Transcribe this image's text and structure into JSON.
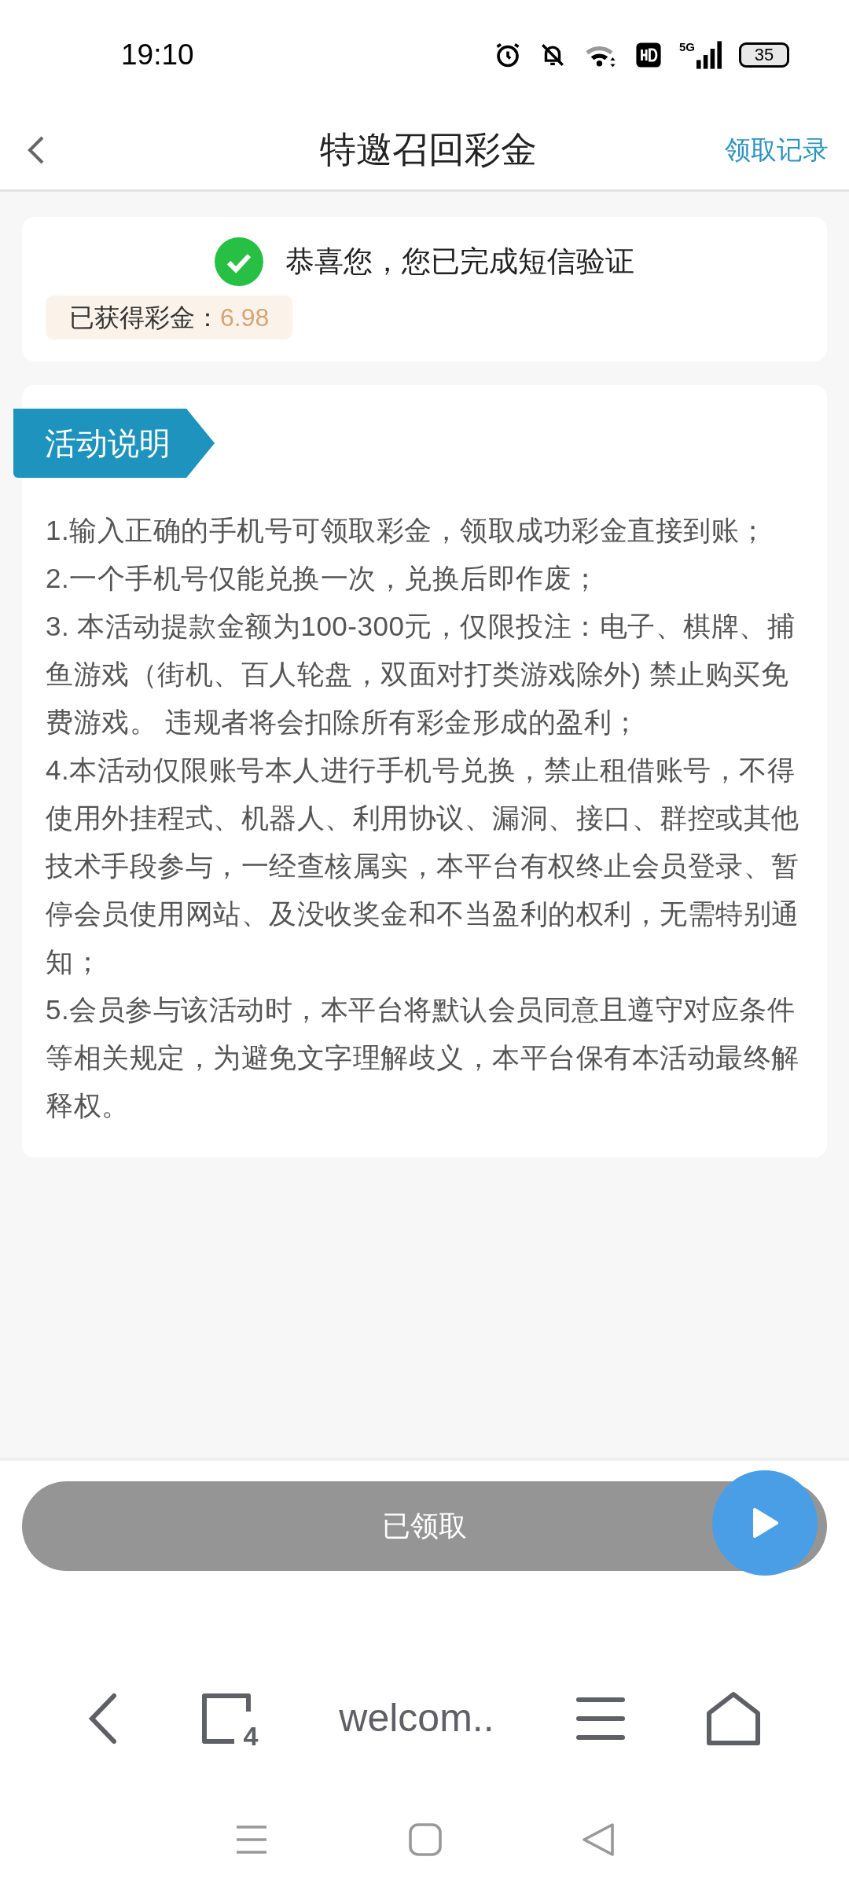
{
  "status_bar": {
    "time": "19:10",
    "network": "5G",
    "battery": "35"
  },
  "header": {
    "title": "特邀召回彩金",
    "action": "领取记录"
  },
  "result": {
    "verified": true,
    "message": "恭喜您，您已完成短信验证",
    "bonus_label": "已获得彩金：",
    "bonus_value": "6.98"
  },
  "rules": {
    "title": "活动说明",
    "items": [
      "1.输入正确的手机号可领取彩金，领取成功彩金直接到账；",
      "2.一个手机号仅能兑换一次，兑换后即作废；",
      "3. 本活动提款金额为100-300元，仅限投注：电子、棋牌、捕鱼游戏（街机、百人轮盘，双面对打类游戏除外) 禁止购买免费游戏。 违规者将会扣除所有彩金形成的盈利；",
      "4.本活动仅限账号本人进行手机号兑换，禁止租借账号，不得使用外挂程式、机器人、利用协议、漏洞、接口、群控或其他技术手段参与，一经查核属实，本平台有权终止会员登录、暂停会员使用网站、及没收奖金和不当盈利的权利，无需特别通知；",
      "5.会员参与该活动时，本平台将默认会员同意且遵守对应条件等相关规定，为避免文字理解歧义，本平台保有本活动最终解释权。"
    ]
  },
  "claim_button": {
    "label": "已领取",
    "claimed": true
  },
  "browser_bar": {
    "tab_count": "4",
    "address": "welcom.."
  }
}
